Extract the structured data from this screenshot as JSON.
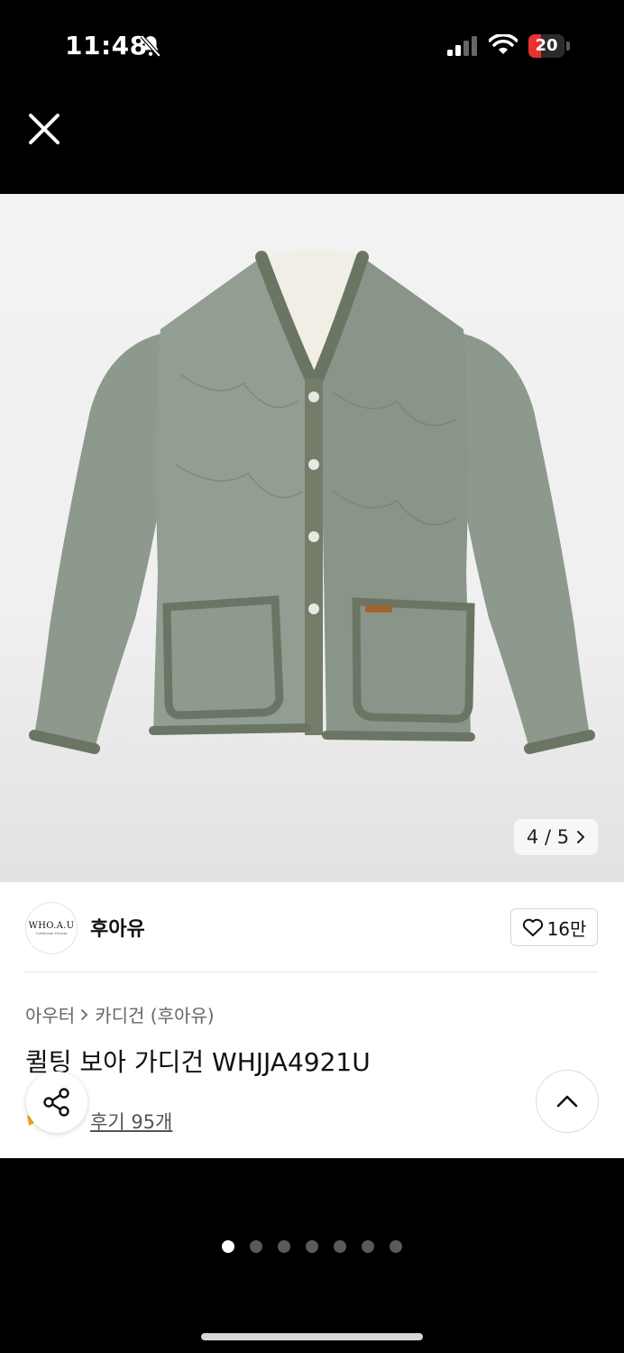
{
  "status_bar": {
    "time": "11:48",
    "battery_level": "20"
  },
  "gallery": {
    "counter": "4 / 5"
  },
  "brand": {
    "logo_text": "WHO.A.U",
    "logo_sub": "California Dream",
    "name": "후아유"
  },
  "like": {
    "count": "16만"
  },
  "breadcrumb": {
    "items": [
      "아우터",
      "카디건 (후아유)"
    ]
  },
  "product": {
    "title": "퀼팅 보아 가디건 WHJJA4921U"
  },
  "reviews": {
    "label": "후기 95개"
  },
  "page_dots": {
    "count": 7,
    "active_index": 0
  },
  "colors": {
    "accent_star": "#f5a623",
    "battery_red": "#e8322f",
    "jacket": "#8e998d",
    "trim": "#6b7563"
  }
}
